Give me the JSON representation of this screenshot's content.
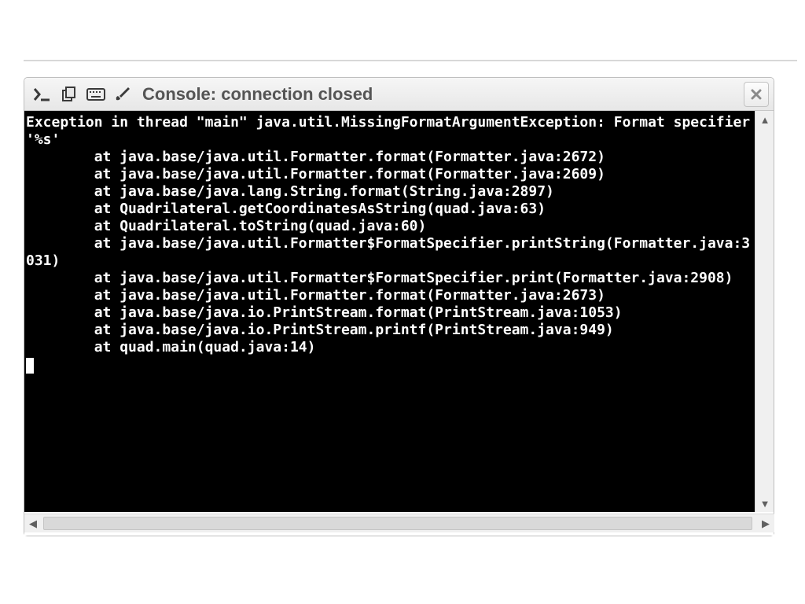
{
  "titlebar": {
    "title": "Console: connection closed"
  },
  "console": {
    "lines": [
      "Exception in thread \"main\" java.util.MissingFormatArgumentException: Format specifier '%s'",
      "        at java.base/java.util.Formatter.format(Formatter.java:2672)",
      "        at java.base/java.util.Formatter.format(Formatter.java:2609)",
      "        at java.base/java.lang.String.format(String.java:2897)",
      "        at Quadrilateral.getCoordinatesAsString(quad.java:63)",
      "        at Quadrilateral.toString(quad.java:60)",
      "        at java.base/java.util.Formatter$FormatSpecifier.printString(Formatter.java:3031)",
      "        at java.base/java.util.Formatter$FormatSpecifier.print(Formatter.java:2908)",
      "        at java.base/java.util.Formatter.format(Formatter.java:2673)",
      "        at java.base/java.io.PrintStream.format(PrintStream.java:1053)",
      "        at java.base/java.io.PrintStream.printf(PrintStream.java:949)",
      "        at quad.main(quad.java:14)"
    ]
  }
}
